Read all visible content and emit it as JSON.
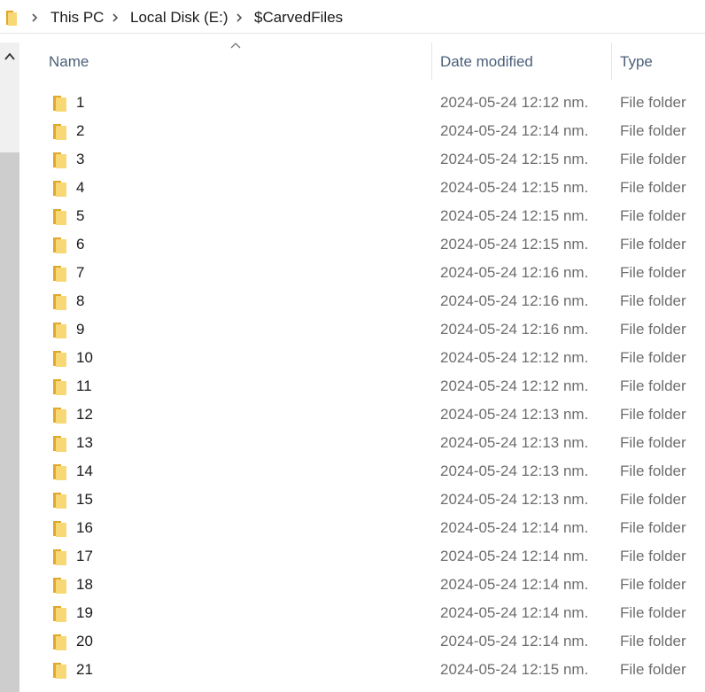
{
  "breadcrumb": {
    "items": [
      "This PC",
      "Local Disk (E:)",
      "$CarvedFiles"
    ]
  },
  "columns": {
    "name": "Name",
    "date_modified": "Date modified",
    "type": "Type",
    "sort_indicator": "ascending"
  },
  "rows": [
    {
      "name": "1",
      "date": "2024-05-24 12:12 nm.",
      "type": "File folder"
    },
    {
      "name": "2",
      "date": "2024-05-24 12:14 nm.",
      "type": "File folder"
    },
    {
      "name": "3",
      "date": "2024-05-24 12:15 nm.",
      "type": "File folder"
    },
    {
      "name": "4",
      "date": "2024-05-24 12:15 nm.",
      "type": "File folder"
    },
    {
      "name": "5",
      "date": "2024-05-24 12:15 nm.",
      "type": "File folder"
    },
    {
      "name": "6",
      "date": "2024-05-24 12:15 nm.",
      "type": "File folder"
    },
    {
      "name": "7",
      "date": "2024-05-24 12:16 nm.",
      "type": "File folder"
    },
    {
      "name": "8",
      "date": "2024-05-24 12:16 nm.",
      "type": "File folder"
    },
    {
      "name": "9",
      "date": "2024-05-24 12:16 nm.",
      "type": "File folder"
    },
    {
      "name": "10",
      "date": "2024-05-24 12:12 nm.",
      "type": "File folder"
    },
    {
      "name": "11",
      "date": "2024-05-24 12:12 nm.",
      "type": "File folder"
    },
    {
      "name": "12",
      "date": "2024-05-24 12:13 nm.",
      "type": "File folder"
    },
    {
      "name": "13",
      "date": "2024-05-24 12:13 nm.",
      "type": "File folder"
    },
    {
      "name": "14",
      "date": "2024-05-24 12:13 nm.",
      "type": "File folder"
    },
    {
      "name": "15",
      "date": "2024-05-24 12:13 nm.",
      "type": "File folder"
    },
    {
      "name": "16",
      "date": "2024-05-24 12:14 nm.",
      "type": "File folder"
    },
    {
      "name": "17",
      "date": "2024-05-24 12:14 nm.",
      "type": "File folder"
    },
    {
      "name": "18",
      "date": "2024-05-24 12:14 nm.",
      "type": "File folder"
    },
    {
      "name": "19",
      "date": "2024-05-24 12:14 nm.",
      "type": "File folder"
    },
    {
      "name": "20",
      "date": "2024-05-24 12:14 nm.",
      "type": "File folder"
    },
    {
      "name": "21",
      "date": "2024-05-24 12:15 nm.",
      "type": "File folder"
    }
  ],
  "icons": {
    "folder": "folder-icon",
    "separator": "chevron-right-icon",
    "scroll_up": "chevron-up-icon",
    "sort": "sort-caret-icon"
  },
  "colors": {
    "folder_yellow": "#f8d775",
    "folder_dark": "#e0a82e",
    "header_text": "#4c607a",
    "secondary_text": "#6d6d6d",
    "scroll_thumb": "#cdcdcd"
  }
}
